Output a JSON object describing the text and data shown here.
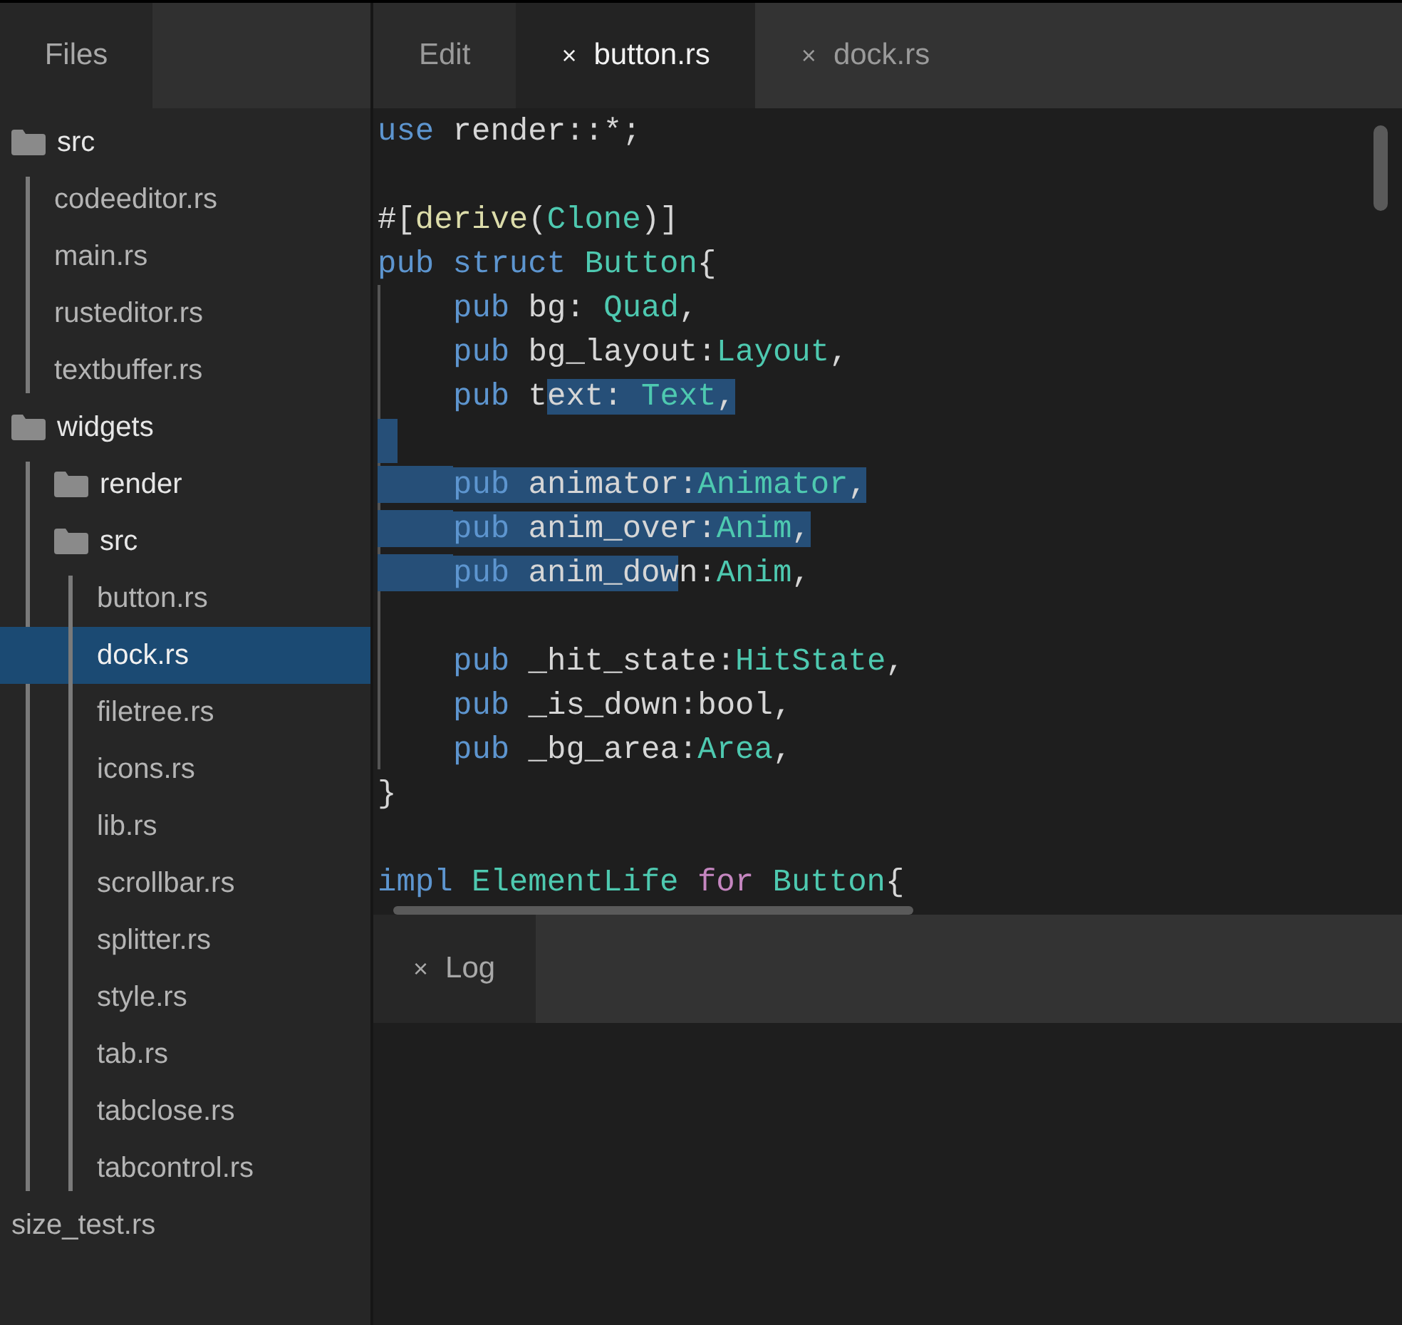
{
  "sidebar": {
    "tabs": [
      {
        "label": "Files",
        "selected": true
      }
    ],
    "tree": [
      {
        "name": "src",
        "kind": "folder",
        "selected": false,
        "children": [
          {
            "name": "codeeditor.rs",
            "kind": "file",
            "selected": false
          },
          {
            "name": "main.rs",
            "kind": "file",
            "selected": false
          },
          {
            "name": "rusteditor.rs",
            "kind": "file",
            "selected": false
          },
          {
            "name": "textbuffer.rs",
            "kind": "file",
            "selected": false
          }
        ]
      },
      {
        "name": "widgets",
        "kind": "folder",
        "selected": false,
        "children": [
          {
            "name": "render",
            "kind": "folder",
            "selected": false
          },
          {
            "name": "src",
            "kind": "folder",
            "selected": false,
            "children": [
              {
                "name": "button.rs",
                "kind": "file",
                "selected": false
              },
              {
                "name": "dock.rs",
                "kind": "file",
                "selected": true
              },
              {
                "name": "filetree.rs",
                "kind": "file",
                "selected": false
              },
              {
                "name": "icons.rs",
                "kind": "file",
                "selected": false
              },
              {
                "name": "lib.rs",
                "kind": "file",
                "selected": false
              },
              {
                "name": "scrollbar.rs",
                "kind": "file",
                "selected": false
              },
              {
                "name": "splitter.rs",
                "kind": "file",
                "selected": false
              },
              {
                "name": "style.rs",
                "kind": "file",
                "selected": false
              },
              {
                "name": "tab.rs",
                "kind": "file",
                "selected": false
              },
              {
                "name": "tabclose.rs",
                "kind": "file",
                "selected": false
              },
              {
                "name": "tabcontrol.rs",
                "kind": "file",
                "selected": false
              }
            ]
          }
        ]
      },
      {
        "name": "size_test.rs",
        "kind": "file",
        "selected": false
      }
    ]
  },
  "editor": {
    "tabs": [
      {
        "label": "Edit",
        "selected": false
      },
      {
        "label": "button.rs",
        "close": "×",
        "selected": true
      },
      {
        "label": "dock.rs",
        "close": "×",
        "selected": false
      }
    ],
    "lines": [
      {
        "kind": "code",
        "indented": false,
        "tokens": [
          {
            "text": "use",
            "kind": "keyword",
            "selected": false
          },
          {
            "text": " render::*;",
            "kind": "plain",
            "selected": false
          }
        ]
      },
      {
        "kind": "blank",
        "selected": false
      },
      {
        "kind": "code",
        "indented": false,
        "tokens": [
          {
            "text": "#[",
            "kind": "plain",
            "selected": false
          },
          {
            "text": "derive",
            "kind": "macro",
            "selected": false
          },
          {
            "text": "(",
            "kind": "plain",
            "selected": false
          },
          {
            "text": "Clone",
            "kind": "type",
            "selected": false
          },
          {
            "text": ")]",
            "kind": "plain",
            "selected": false
          }
        ]
      },
      {
        "kind": "code",
        "indented": false,
        "tokens": [
          {
            "text": "pub",
            "kind": "keyword",
            "selected": false
          },
          {
            "text": " struct",
            "kind": "keyword",
            "selected": false
          },
          {
            "text": " Button",
            "kind": "type",
            "selected": false
          },
          {
            "text": "{",
            "kind": "plain",
            "selected": false
          }
        ]
      },
      {
        "kind": "code",
        "indented": true,
        "tokens": [
          {
            "text": "pub",
            "kind": "keyword",
            "selected": false
          },
          {
            "text": " bg: ",
            "kind": "plain",
            "selected": false
          },
          {
            "text": "Quad",
            "kind": "type",
            "selected": false
          },
          {
            "text": ",",
            "kind": "plain",
            "selected": false
          }
        ]
      },
      {
        "kind": "code",
        "indented": true,
        "tokens": [
          {
            "text": "pub",
            "kind": "keyword",
            "selected": false
          },
          {
            "text": " bg_layout:",
            "kind": "plain",
            "selected": false
          },
          {
            "text": "Layout",
            "kind": "type",
            "selected": false
          },
          {
            "text": ",",
            "kind": "plain",
            "selected": false
          }
        ]
      },
      {
        "kind": "code",
        "indented": true,
        "tokens": [
          {
            "text": "pub",
            "kind": "keyword",
            "selected": false
          },
          {
            "text": " t",
            "kind": "plain",
            "selected": false
          },
          {
            "text": "ext: ",
            "kind": "plain",
            "selected": true
          },
          {
            "text": "Text",
            "kind": "type",
            "selected": true
          },
          {
            "text": ",",
            "kind": "plain",
            "selected": true
          }
        ]
      },
      {
        "kind": "blank",
        "selected": true
      },
      {
        "kind": "code",
        "indented": true,
        "tokens": [
          {
            "text": "pub",
            "kind": "keyword",
            "selected": true
          },
          {
            "text": " animator:",
            "kind": "plain",
            "selected": true
          },
          {
            "text": "Animator",
            "kind": "type",
            "selected": true
          },
          {
            "text": ",",
            "kind": "plain",
            "selected": true
          }
        ]
      },
      {
        "kind": "code",
        "indented": true,
        "tokens": [
          {
            "text": "pub",
            "kind": "keyword",
            "selected": true
          },
          {
            "text": " anim_over:",
            "kind": "plain",
            "selected": true
          },
          {
            "text": "Anim",
            "kind": "type",
            "selected": true
          },
          {
            "text": ",",
            "kind": "plain",
            "selected": true
          }
        ]
      },
      {
        "kind": "code",
        "indented": true,
        "tokens": [
          {
            "text": "pub",
            "kind": "keyword",
            "selected": true
          },
          {
            "text": " anim_dow",
            "kind": "plain",
            "selected": true
          },
          {
            "text": "n:",
            "kind": "plain",
            "selected": false
          },
          {
            "text": "Anim",
            "kind": "type",
            "selected": false
          },
          {
            "text": ",",
            "kind": "plain",
            "selected": false
          }
        ]
      },
      {
        "kind": "blank",
        "selected": false
      },
      {
        "kind": "code",
        "indented": true,
        "tokens": [
          {
            "text": "pub",
            "kind": "keyword",
            "selected": false
          },
          {
            "text": " _hit_state:",
            "kind": "plain",
            "selected": false
          },
          {
            "text": "HitState",
            "kind": "type",
            "selected": false
          },
          {
            "text": ",",
            "kind": "plain",
            "selected": false
          }
        ]
      },
      {
        "kind": "code",
        "indented": true,
        "tokens": [
          {
            "text": "pub",
            "kind": "keyword",
            "selected": false
          },
          {
            "text": " _is_down:bool,",
            "kind": "plain",
            "selected": false
          }
        ]
      },
      {
        "kind": "code",
        "indented": true,
        "tokens": [
          {
            "text": "pub",
            "kind": "keyword",
            "selected": false
          },
          {
            "text": " _bg_area:",
            "kind": "plain",
            "selected": false
          },
          {
            "text": "Area",
            "kind": "type",
            "selected": false
          },
          {
            "text": ",",
            "kind": "plain",
            "selected": false
          }
        ]
      },
      {
        "kind": "code",
        "indented": false,
        "tokens": [
          {
            "text": "}",
            "kind": "plain",
            "selected": false
          }
        ]
      },
      {
        "kind": "blank",
        "selected": false
      },
      {
        "kind": "code",
        "indented": false,
        "tokens": [
          {
            "text": "impl",
            "kind": "keyword",
            "selected": false
          },
          {
            "text": " ElementLife",
            "kind": "type",
            "selected": false
          },
          {
            "text": " for",
            "kind": "control",
            "selected": false
          },
          {
            "text": " Button",
            "kind": "type",
            "selected": false
          },
          {
            "text": "{",
            "kind": "plain",
            "selected": false
          }
        ]
      }
    ]
  },
  "log_panel": {
    "tabs": [
      {
        "label": "Log",
        "close": "×",
        "selected": true
      }
    ]
  }
}
